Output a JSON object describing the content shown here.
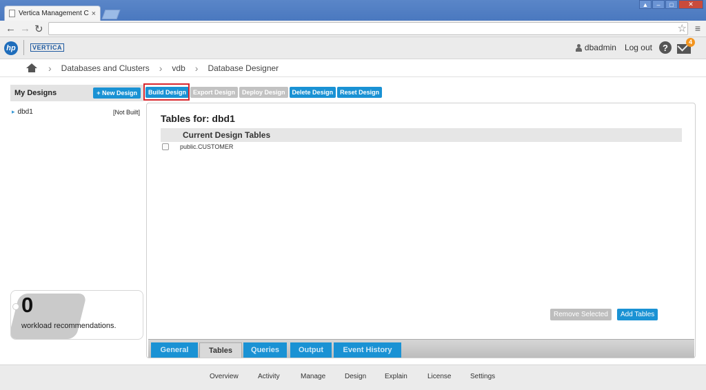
{
  "browser": {
    "tab_title": "Vertica Management Co",
    "tab_close": "×",
    "address": ""
  },
  "header": {
    "hp_logo": "hp",
    "vertica_logo": "VERTICA",
    "username": "dbadmin",
    "logout": "Log out",
    "help": "?",
    "notification_count": "4"
  },
  "breadcrumb": {
    "items": [
      "Databases and Clusters",
      "vdb",
      "Database Designer"
    ]
  },
  "sidebar": {
    "title": "My Designs",
    "new_design": "+ New Design",
    "designs": [
      {
        "name": "dbd1",
        "status": "[Not Built]"
      }
    ],
    "workload": {
      "count": "0",
      "label": "workload recommendations."
    }
  },
  "actions": [
    {
      "label": "Build Design",
      "enabled": true
    },
    {
      "label": "Export Design",
      "enabled": false
    },
    {
      "label": "Deploy Design",
      "enabled": false
    },
    {
      "label": "Delete Design",
      "enabled": true
    },
    {
      "label": "Reset Design",
      "enabled": true
    }
  ],
  "main": {
    "title": "Tables for: dbd1",
    "table_header": "Current Design Tables",
    "rows": [
      "public.CUSTOMER"
    ],
    "remove_selected": "Remove Selected",
    "add_tables": "Add Tables",
    "tabs": [
      {
        "label": "General",
        "active": false
      },
      {
        "label": "Tables",
        "active": true
      },
      {
        "label": "Queries",
        "active": false
      },
      {
        "label": "Output",
        "active": false
      },
      {
        "label": "Event History",
        "active": false
      }
    ]
  },
  "bottom_nav": [
    "Overview",
    "Activity",
    "Manage",
    "Design",
    "Explain",
    "License",
    "Settings"
  ],
  "colors": {
    "accent": "#1a92d4",
    "disabled": "#c2c2c2",
    "highlight": "#d8262d",
    "badge": "#f3941e"
  }
}
